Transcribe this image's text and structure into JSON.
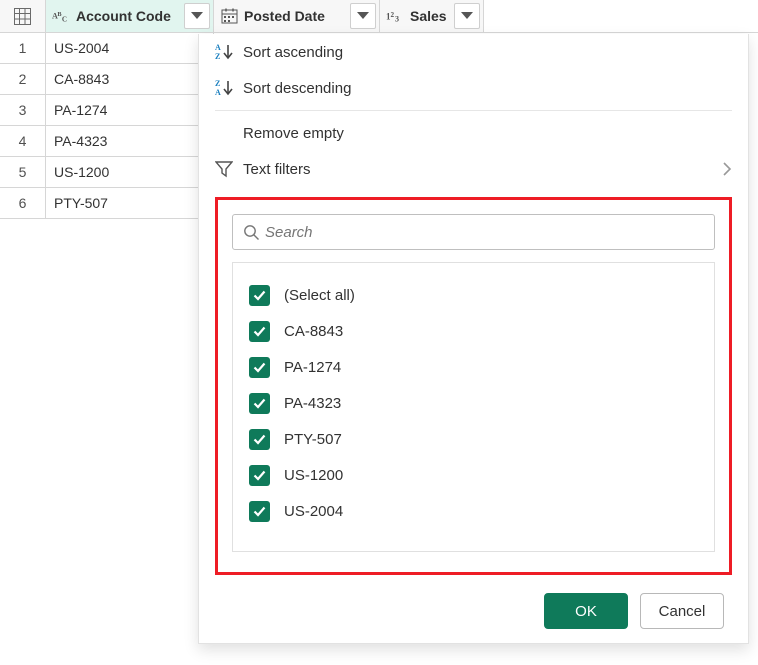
{
  "columns": {
    "account": {
      "label": "Account Code",
      "type": "text"
    },
    "posted": {
      "label": "Posted Date",
      "type": "date"
    },
    "sales": {
      "label": "Sales",
      "type": "number"
    }
  },
  "rows": [
    {
      "n": "1",
      "account": "US-2004"
    },
    {
      "n": "2",
      "account": "CA-8843"
    },
    {
      "n": "3",
      "account": "PA-1274"
    },
    {
      "n": "4",
      "account": "PA-4323"
    },
    {
      "n": "5",
      "account": "US-1200"
    },
    {
      "n": "6",
      "account": "PTY-507"
    }
  ],
  "menu": {
    "sort_asc": "Sort ascending",
    "sort_desc": "Sort descending",
    "remove_empty": "Remove empty",
    "text_filters": "Text filters"
  },
  "search": {
    "placeholder": "Search"
  },
  "filter_values": [
    "(Select all)",
    "CA-8843",
    "PA-1274",
    "PA-4323",
    "PTY-507",
    "US-1200",
    "US-2004"
  ],
  "buttons": {
    "ok": "OK",
    "cancel": "Cancel"
  },
  "colors": {
    "accent": "#0f7a5a",
    "highlight": "#ee1c25"
  }
}
